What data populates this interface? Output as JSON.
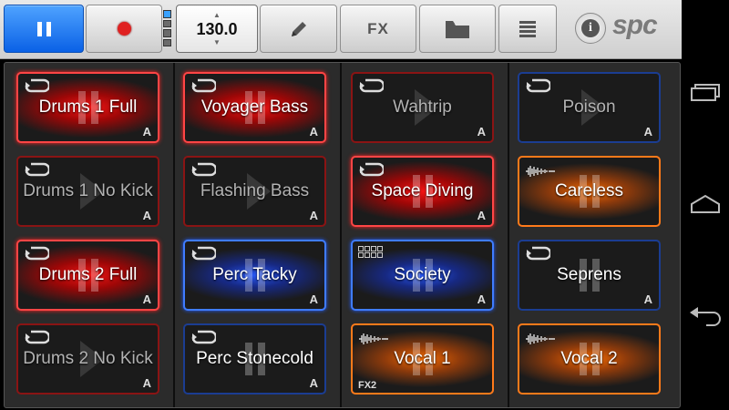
{
  "toolbar": {
    "bpm": "130.0",
    "fx_label": "FX",
    "logo": "spc",
    "info_label": "i"
  },
  "pads": {
    "col1": [
      {
        "name": "Drums 1 Full",
        "group": "A",
        "state": "playing",
        "color": "#ff2020"
      },
      {
        "name": "Drums 1 No Kick",
        "group": "A",
        "state": "stopped",
        "color": "#8a1414"
      },
      {
        "name": "Drums 2 Full",
        "group": "A",
        "state": "playing",
        "color": "#ff2020"
      },
      {
        "name": "Drums 2 No Kick",
        "group": "A",
        "state": "stopped",
        "color": "#8a1414"
      }
    ],
    "col2": [
      {
        "name": "Voyager Bass",
        "group": "A",
        "state": "playing",
        "color": "#ff2020"
      },
      {
        "name": "Flashing Bass",
        "group": "A",
        "state": "stopped",
        "color": "#8a1414"
      },
      {
        "name": "Perc Tacky",
        "group": "A",
        "state": "playing",
        "color": "#2f6bff"
      },
      {
        "name": "Perc Stonecold",
        "group": "A",
        "state": "stopped",
        "color": "#1b3d92"
      }
    ],
    "col3": [
      {
        "name": "Wahtrip",
        "group": "A",
        "state": "stopped",
        "color": "#8a1414"
      },
      {
        "name": "Space Diving",
        "group": "A",
        "state": "playing",
        "color": "#ff2020"
      },
      {
        "name": "Society",
        "group": "A",
        "state": "playing",
        "color": "#2f6bff"
      },
      {
        "name": "Vocal 1",
        "group": "",
        "fx": "FX2",
        "state": "playing",
        "color": "#ff7a1a"
      }
    ],
    "col4": [
      {
        "name": "Poison",
        "group": "A",
        "state": "stopped",
        "color": "#1b3d92"
      },
      {
        "name": "Careless",
        "group": "",
        "state": "playing",
        "color": "#ff7a1a"
      },
      {
        "name": "Seprens",
        "group": "A",
        "state": "stopped",
        "color": "#1b3d92"
      },
      {
        "name": "Vocal 2",
        "group": "",
        "state": "playing",
        "color": "#ff7a1a"
      }
    ]
  },
  "icons": {
    "play_pause": "pause-icon",
    "record": "record-icon",
    "edit": "pencil-icon",
    "folder": "folder-icon",
    "list": "list-icon",
    "info": "info-icon",
    "loop": "loop-icon",
    "waveform": "waveform-icon",
    "grid": "grid-icon",
    "nav_recent": "recent-apps-icon",
    "nav_home": "home-icon",
    "nav_back": "back-icon"
  }
}
